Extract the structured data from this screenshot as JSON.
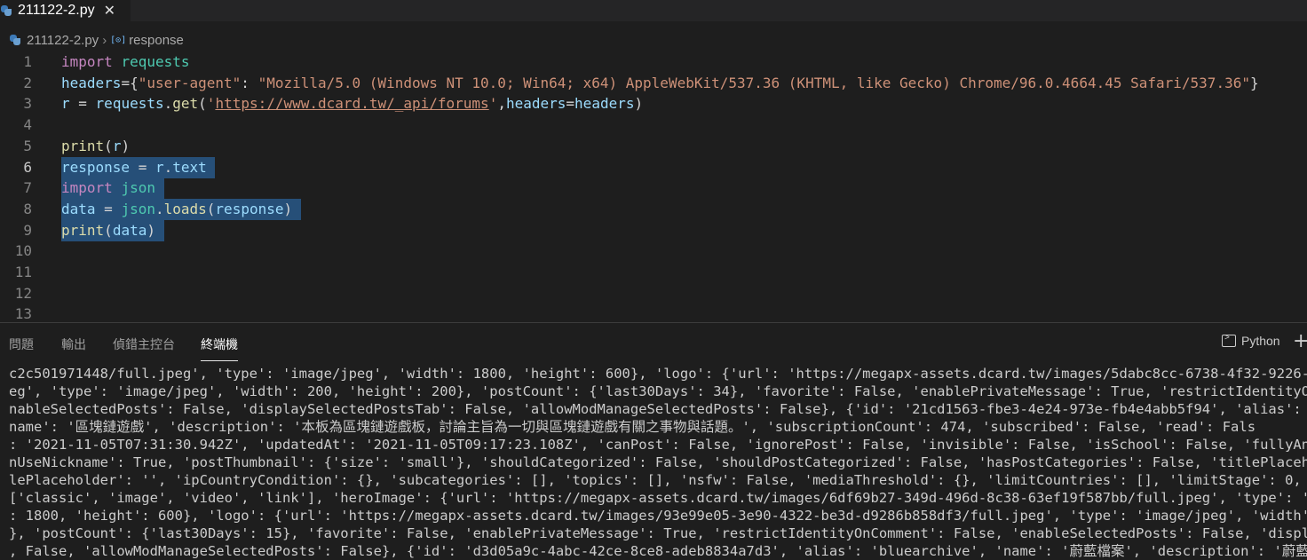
{
  "tab": {
    "filename": "211122-2.py",
    "close_glyph": "✕",
    "icon": "python-file-icon"
  },
  "breadcrumb": {
    "file": "211122-2.py",
    "symbol": "response",
    "symbol_icon": "variable-symbol-icon"
  },
  "editor": {
    "line_numbers": [
      "1",
      "2",
      "3",
      "4",
      "5",
      "6",
      "7",
      "8",
      "9",
      "10",
      "11",
      "12",
      "13"
    ],
    "lines": [
      [
        [
          "kw",
          "import"
        ],
        [
          "punc",
          " "
        ],
        [
          "mod",
          "requests"
        ]
      ],
      [
        [
          "id",
          "headers"
        ],
        [
          "punc",
          "={"
        ],
        [
          "str",
          "\"user-agent\""
        ],
        [
          "punc",
          ": "
        ],
        [
          "str",
          "\"Mozilla/5.0 (Windows NT 10.0; Win64; x64) AppleWebKit/537.36 (KHTML, like Gecko) Chrome/96.0.4664.45 Safari/537.36\""
        ],
        [
          "punc",
          "}"
        ]
      ],
      [
        [
          "id",
          "r"
        ],
        [
          "punc",
          " = "
        ],
        [
          "id",
          "requests"
        ],
        [
          "punc",
          "."
        ],
        [
          "fn",
          "get"
        ],
        [
          "punc",
          "("
        ],
        [
          "str",
          "'"
        ],
        [
          "url",
          "https://www.dcard.tw/_api/forums"
        ],
        [
          "str",
          "'"
        ],
        [
          "punc",
          ","
        ],
        [
          "id",
          "headers"
        ],
        [
          "punc",
          "="
        ],
        [
          "id",
          "headers"
        ],
        [
          "punc",
          ")"
        ]
      ],
      [],
      [
        [
          "fn",
          "print"
        ],
        [
          "punc",
          "("
        ],
        [
          "id",
          "r"
        ],
        [
          "punc",
          ")"
        ]
      ],
      [
        [
          "id",
          "response"
        ],
        [
          "punc",
          " = "
        ],
        [
          "id",
          "r"
        ],
        [
          "punc",
          "."
        ],
        [
          "id",
          "text"
        ],
        [
          "punc",
          " "
        ]
      ],
      [
        [
          "kw",
          "import"
        ],
        [
          "punc",
          " "
        ],
        [
          "mod",
          "json"
        ],
        [
          "punc",
          " "
        ]
      ],
      [
        [
          "id",
          "data"
        ],
        [
          "punc",
          " = "
        ],
        [
          "mod",
          "json"
        ],
        [
          "punc",
          "."
        ],
        [
          "fn",
          "loads"
        ],
        [
          "punc",
          "("
        ],
        [
          "id",
          "response"
        ],
        [
          "punc",
          ")"
        ],
        [
          "punc",
          " "
        ]
      ],
      [
        [
          "fn",
          "print"
        ],
        [
          "punc",
          "("
        ],
        [
          "id",
          "data"
        ],
        [
          "punc",
          ")"
        ],
        [
          "punc",
          " "
        ]
      ],
      [],
      [],
      [],
      []
    ],
    "selected_lines": [
      5,
      6,
      7,
      8
    ]
  },
  "panel": {
    "tabs": [
      "問題",
      "輸出",
      "偵錯主控台",
      "終端機"
    ],
    "active_tab": "終端機",
    "terminal_profile": "Python",
    "new_terminal": "+"
  },
  "terminal_lines": [
    "c2c501971448/full.jpeg', 'type': 'image/jpeg', 'width': 1800, 'height': 600}, 'logo': {'url': 'https://megapx-assets.dcard.tw/images/5dabc8cc-6738-4f32-9226-4a046a",
    "eg', 'type': 'image/jpeg', 'width': 200, 'height': 200}, 'postCount': {'last30Days': 34}, 'favorite': False, 'enablePrivateMessage': True, 'restrictIdentityOnComme",
    "nableSelectedPosts': False, 'displaySelectedPostsTab': False, 'allowModManageSelectedPosts': False}, {'id': '21cd1563-fbe3-4e24-973e-fb4e4abb5f94', 'alias': 'block",
    "name': '區塊鏈遊戲', 'description': '本板為區塊鏈遊戲板，討論主旨為一切與區塊鏈遊戲有關之事物與話題。', 'subscriptionCount': 474, 'subscribed': False, 'read': Fals",
    ": '2021-11-05T07:31:30.942Z', 'updatedAt': '2021-11-05T09:17:23.108Z', 'canPost': False, 'ignorePost': False, 'invisible': False, 'isSchool': False, 'fullyAnonymou",
    "nUseNickname': True, 'postThumbnail': {'size': 'small'}, 'shouldCategorized': False, 'shouldPostCategorized': False, 'hasPostCategories': False, 'titlePlaceholder'",
    "lePlaceholder': '', 'ipCountryCondition': {}, 'subcategories': [], 'topics': [], 'nsfw': False, 'mediaThreshold': {}, 'limitCountries': [], 'limitStage': 0, 'avail",
    "['classic', 'image', 'video', 'link'], 'heroImage': {'url': 'https://megapx-assets.dcard.tw/images/6df69b27-349d-496d-8c38-63ef19f587bb/full.jpeg', 'type': 'image/",
    ": 1800, 'height': 600}, 'logo': {'url': 'https://megapx-assets.dcard.tw/images/93e99e05-3e90-4322-be3d-d9286b858df3/full.jpeg', 'type': 'image/jpeg', 'width': 200,",
    "}, 'postCount': {'last30Days': 15}, 'favorite': False, 'enablePrivateMessage': True, 'restrictIdentityOnComment': False, 'enableSelectedPosts': False, 'displaySele",
    ", False, 'allowModManageSelectedPosts': False}, {'id': 'd3d05a9c-4abc-42ce-8ce8-adeb8834a7d3', 'alias': 'bluearchive', 'name': '蔚藍檔案', 'description': '蔚藍檔案板"
  ]
}
